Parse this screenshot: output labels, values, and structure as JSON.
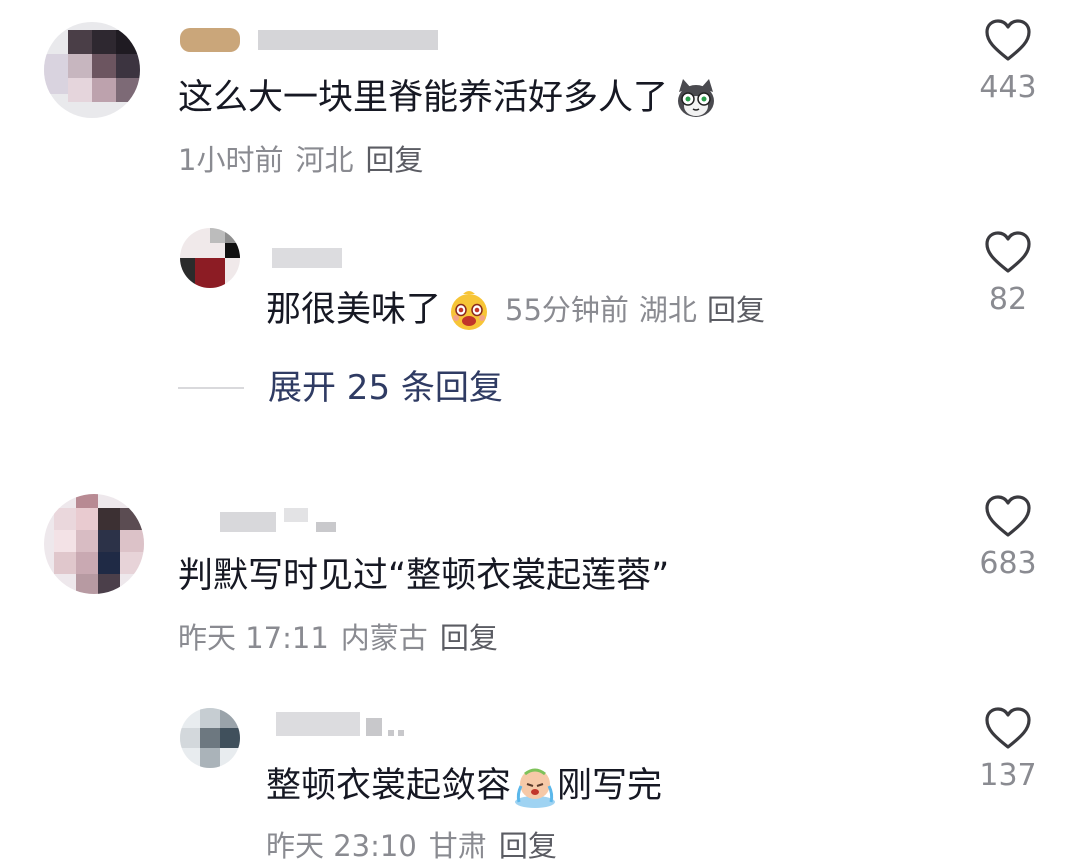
{
  "comments": [
    {
      "text": "这么大一块里脊能养活好多人了",
      "emoji": "cat-emoji",
      "time": "1小时前",
      "location": "河北",
      "reply_label": "回复",
      "likes": "443"
    },
    {
      "text": "那很美味了",
      "emoji": "drooling-face-emoji",
      "time": "55分钟前",
      "location": "湖北",
      "reply_label": "回复",
      "likes": "82"
    },
    {
      "text": "判默写时见过“整顿衣裳起莲蓉”",
      "time": "昨天 17:11",
      "location": "内蒙古",
      "reply_label": "回复",
      "likes": "683"
    },
    {
      "text": "整顿衣裳起敛容",
      "text_after": "刚写完",
      "emoji": "crying-face-emoji",
      "time": "昨天 23:10",
      "location": "甘肃",
      "reply_label": "回复",
      "likes": "137"
    }
  ],
  "expand_replies": "展开 25 条回复",
  "colors": {
    "text": "#161823",
    "meta": "#8a8b91",
    "expand": "#2f3b63",
    "heart": "#3a3a3f"
  },
  "icons": {
    "like": "heart-outline-icon"
  }
}
